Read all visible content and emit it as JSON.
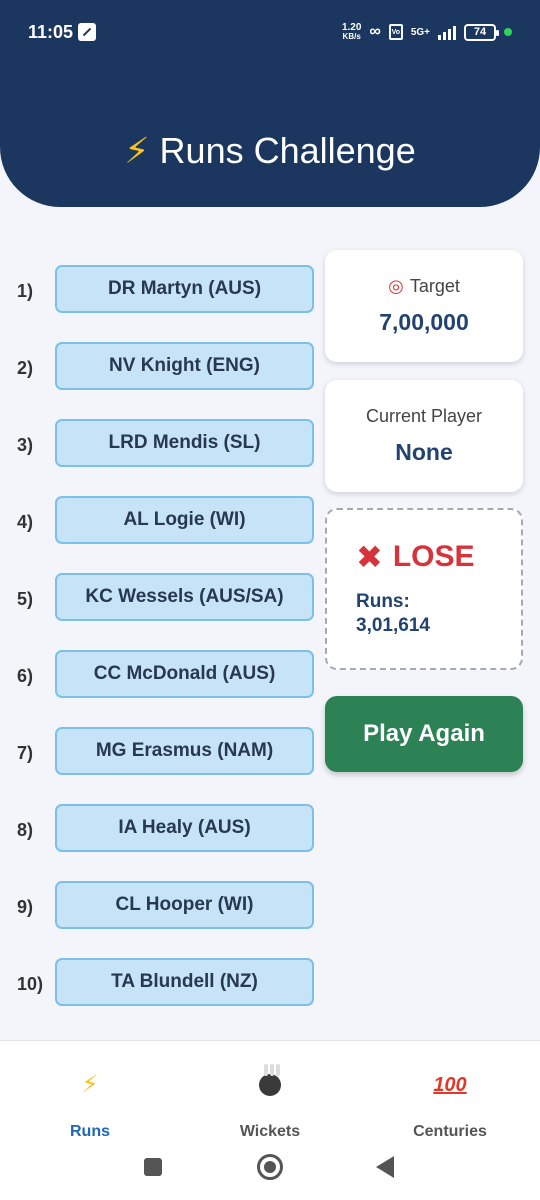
{
  "status_bar": {
    "time": "11:05",
    "net_speed_value": "1.20",
    "net_speed_unit": "KB/s",
    "network": "5G+",
    "battery": "74"
  },
  "header": {
    "title": "Runs Challenge",
    "title_icon": "lightning-bolt"
  },
  "players": [
    {
      "num": "1)",
      "name": "DR Martyn (AUS)"
    },
    {
      "num": "2)",
      "name": "NV Knight (ENG)"
    },
    {
      "num": "3)",
      "name": "LRD Mendis (SL)"
    },
    {
      "num": "4)",
      "name": "AL Logie (WI)"
    },
    {
      "num": "5)",
      "name": "KC Wessels (AUS/SA)"
    },
    {
      "num": "6)",
      "name": "CC McDonald (AUS)"
    },
    {
      "num": "7)",
      "name": "MG Erasmus (NAM)"
    },
    {
      "num": "8)",
      "name": "IA Healy (AUS)"
    },
    {
      "num": "9)",
      "name": "CL Hooper (WI)"
    },
    {
      "num": "10)",
      "name": "TA Blundell (NZ)"
    }
  ],
  "target_card": {
    "label": "Target",
    "value": "7,00,000",
    "icon": "target-icon"
  },
  "current_player_card": {
    "label": "Current Player",
    "value": "None"
  },
  "result_card": {
    "status": "LOSE",
    "icon": "cross-icon",
    "runs_label": "Runs:",
    "runs_value": "3,01,614"
  },
  "play_again_label": "Play Again",
  "bottom_nav": {
    "items": [
      {
        "label": "Runs",
        "icon": "lightning-icon",
        "active": true
      },
      {
        "label": "Wickets",
        "icon": "bowling-icon",
        "active": false
      },
      {
        "label": "Centuries",
        "icon": "hundred-icon",
        "active": false
      }
    ]
  },
  "colors": {
    "header_bg": "#1c375f",
    "player_btn_bg": "#c6e3f8",
    "play_again_bg": "#2c8254",
    "lose_red": "#d8323b",
    "active_tab": "#1f66b5"
  }
}
